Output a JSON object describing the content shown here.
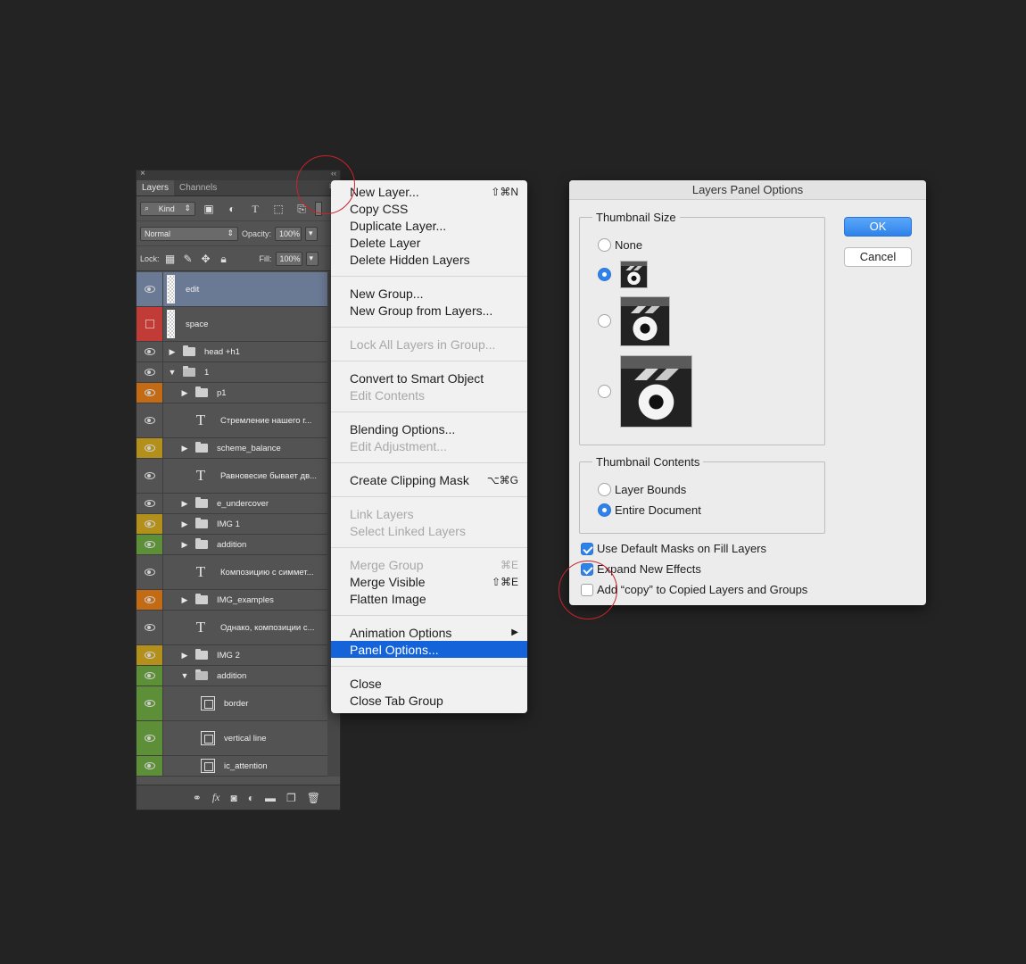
{
  "layers_panel": {
    "close": "×",
    "collapse": "‹‹",
    "tabs": [
      "Layers",
      "Channels"
    ],
    "menu_icon": "≡",
    "kind_label": "Kind",
    "blend_mode": "Normal",
    "opacity_label": "Opacity:",
    "opacity_value": "100%",
    "lock_label": "Lock:",
    "fill_label": "Fill:",
    "fill_value": "100%",
    "layers": [
      {
        "name": "edit",
        "type": "pixel",
        "vis": "eye",
        "selected": true,
        "h": 39,
        "indent": 0
      },
      {
        "name": "space",
        "type": "pixel",
        "vis": "red",
        "h": 39,
        "indent": 0
      },
      {
        "name": "head +h1",
        "type": "group",
        "vis": "eye",
        "h": 23,
        "indent": 0,
        "expanded": false
      },
      {
        "name": "1",
        "type": "group",
        "vis": "eye",
        "h": 23,
        "indent": 0,
        "expanded": true
      },
      {
        "name": "p1",
        "type": "group",
        "vis": "orange",
        "h": 23,
        "indent": 1,
        "expanded": false
      },
      {
        "name": "Стремление нашего г...",
        "type": "text",
        "vis": "eye",
        "h": 39,
        "indent": 1
      },
      {
        "name": "scheme_balance",
        "type": "group",
        "vis": "yellow",
        "h": 23,
        "indent": 1,
        "expanded": false
      },
      {
        "name": "Равновесие бывает дв...",
        "type": "text",
        "vis": "eye",
        "h": 39,
        "indent": 1
      },
      {
        "name": "e_undercover",
        "type": "group",
        "vis": "eye",
        "h": 23,
        "indent": 1,
        "expanded": false
      },
      {
        "name": "IMG 1",
        "type": "group",
        "vis": "yellow",
        "h": 23,
        "indent": 1,
        "expanded": false
      },
      {
        "name": "addition",
        "type": "group",
        "vis": "green",
        "h": 23,
        "indent": 1,
        "expanded": false
      },
      {
        "name": "Композицию с симмет...",
        "type": "text",
        "vis": "eye",
        "h": 39,
        "indent": 1
      },
      {
        "name": "IMG_examples",
        "type": "group",
        "vis": "orange",
        "h": 23,
        "indent": 1,
        "expanded": false
      },
      {
        "name": "Однако, композиции с...",
        "type": "text",
        "vis": "eye",
        "h": 39,
        "indent": 1
      },
      {
        "name": "IMG 2",
        "type": "group",
        "vis": "yellow",
        "h": 23,
        "indent": 1,
        "expanded": false
      },
      {
        "name": "addition",
        "type": "group",
        "vis": "green",
        "h": 23,
        "indent": 1,
        "expanded": true
      },
      {
        "name": "border",
        "type": "smart",
        "vis": "green",
        "h": 39,
        "indent": 2
      },
      {
        "name": "vertical line",
        "type": "smart",
        "vis": "green",
        "h": 39,
        "indent": 2
      },
      {
        "name": "ic_attention",
        "type": "smart",
        "vis": "green",
        "h": 23,
        "indent": 2
      }
    ]
  },
  "context_menu": {
    "items": [
      {
        "label": "New Layer...",
        "shortcut": "⇧⌘N"
      },
      {
        "label": "Copy CSS"
      },
      {
        "label": "Duplicate Layer..."
      },
      {
        "label": "Delete Layer"
      },
      {
        "label": "Delete Hidden Layers"
      },
      {
        "sep": true
      },
      {
        "label": "New Group..."
      },
      {
        "label": "New Group from Layers..."
      },
      {
        "sep": true
      },
      {
        "label": "Lock All Layers in Group...",
        "disabled": true
      },
      {
        "sep": true
      },
      {
        "label": "Convert to Smart Object"
      },
      {
        "label": "Edit Contents",
        "disabled": true
      },
      {
        "sep": true
      },
      {
        "label": "Blending Options..."
      },
      {
        "label": "Edit Adjustment...",
        "disabled": true
      },
      {
        "sep": true
      },
      {
        "label": "Create Clipping Mask",
        "shortcut": "⌥⌘G"
      },
      {
        "sep": true
      },
      {
        "label": "Link Layers",
        "disabled": true
      },
      {
        "label": "Select Linked Layers",
        "disabled": true
      },
      {
        "sep": true
      },
      {
        "label": "Merge Group",
        "shortcut": "⌘E",
        "disabled": true
      },
      {
        "label": "Merge Visible",
        "shortcut": "⇧⌘E"
      },
      {
        "label": "Flatten Image"
      },
      {
        "sep": true
      },
      {
        "label": "Animation Options",
        "submenu": true
      },
      {
        "label": "Panel Options...",
        "highlighted": true
      },
      {
        "sep": true
      },
      {
        "label": "Close"
      },
      {
        "label": "Close Tab Group"
      }
    ]
  },
  "dialog": {
    "title": "Layers Panel Options",
    "thumbnail_size_legend": "Thumbnail Size",
    "none_label": "None",
    "thumbnail_selected": "small",
    "thumbnail_contents_legend": "Thumbnail Contents",
    "layer_bounds_label": "Layer Bounds",
    "entire_document_label": "Entire Document",
    "contents_selected": "entire_document",
    "use_default_masks_label": "Use Default Masks on Fill Layers",
    "use_default_masks": true,
    "expand_effects_label": "Expand New Effects",
    "expand_effects": true,
    "add_copy_label": "Add “copy” to Copied Layers and Groups",
    "add_copy": false,
    "ok_label": "OK",
    "cancel_label": "Cancel"
  }
}
